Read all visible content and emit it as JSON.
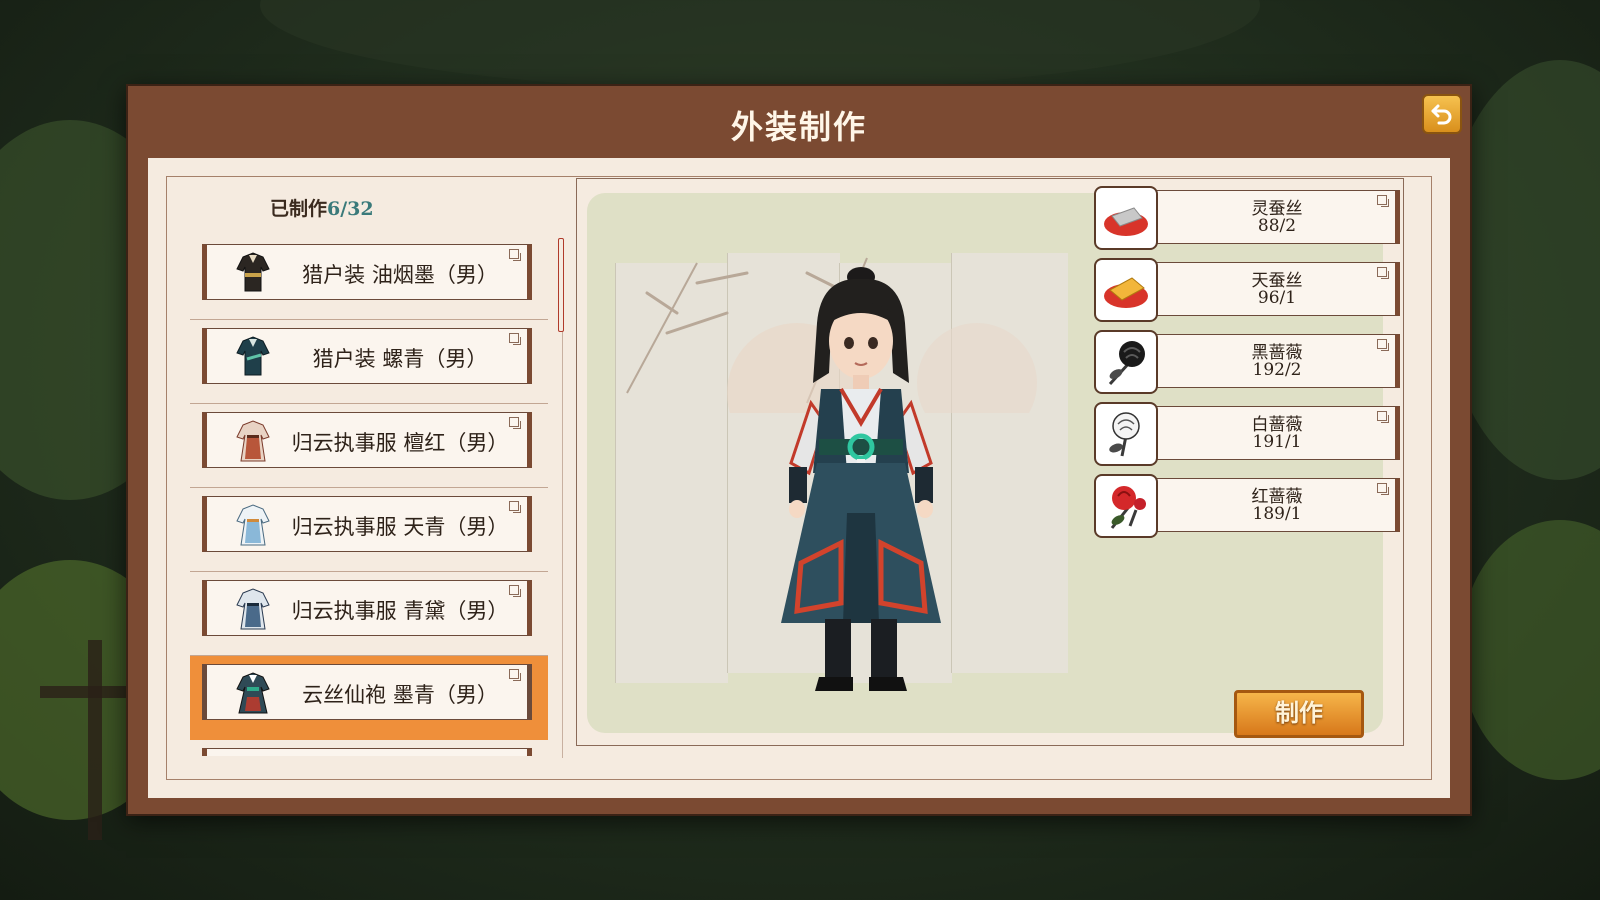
{
  "window": {
    "title": "外装制作",
    "back_icon": "undo-arrow-icon"
  },
  "list": {
    "crafted_label": "已制作",
    "crafted_count": "6/32",
    "items": [
      {
        "label": "猎户装 油烟墨（男）",
        "icon": "hunter-outfit-black-icon",
        "selected": false
      },
      {
        "label": "猎户装 螺青（男）",
        "icon": "hunter-outfit-teal-icon",
        "selected": false
      },
      {
        "label": "归云执事服 檀红（男）",
        "icon": "steward-robe-red-icon",
        "selected": false
      },
      {
        "label": "归云执事服 天青（男）",
        "icon": "steward-robe-skyblue-icon",
        "selected": false
      },
      {
        "label": "归云执事服 青黛（男）",
        "icon": "steward-robe-indigo-icon",
        "selected": false
      },
      {
        "label": "云丝仙袍 墨青（男）",
        "icon": "cloud-silk-robe-icon",
        "selected": true
      }
    ]
  },
  "materials": [
    {
      "name": "灵蚕丝",
      "qty": "88/2",
      "icon": "spirit-silk-icon"
    },
    {
      "name": "天蚕丝",
      "qty": "96/1",
      "icon": "heaven-silk-icon"
    },
    {
      "name": "黑蔷薇",
      "qty": "192/2",
      "icon": "black-rose-icon"
    },
    {
      "name": "白蔷薇",
      "qty": "191/1",
      "icon": "white-rose-icon"
    },
    {
      "name": "红蔷薇",
      "qty": "189/1",
      "icon": "red-rose-icon"
    }
  ],
  "actions": {
    "craft_label": "制作"
  },
  "colors": {
    "window_brown": "#7b4a32",
    "panel_cream": "#f5ebe0",
    "selected_orange": "#ef8f3a",
    "count_teal": "#3a7a7a"
  }
}
